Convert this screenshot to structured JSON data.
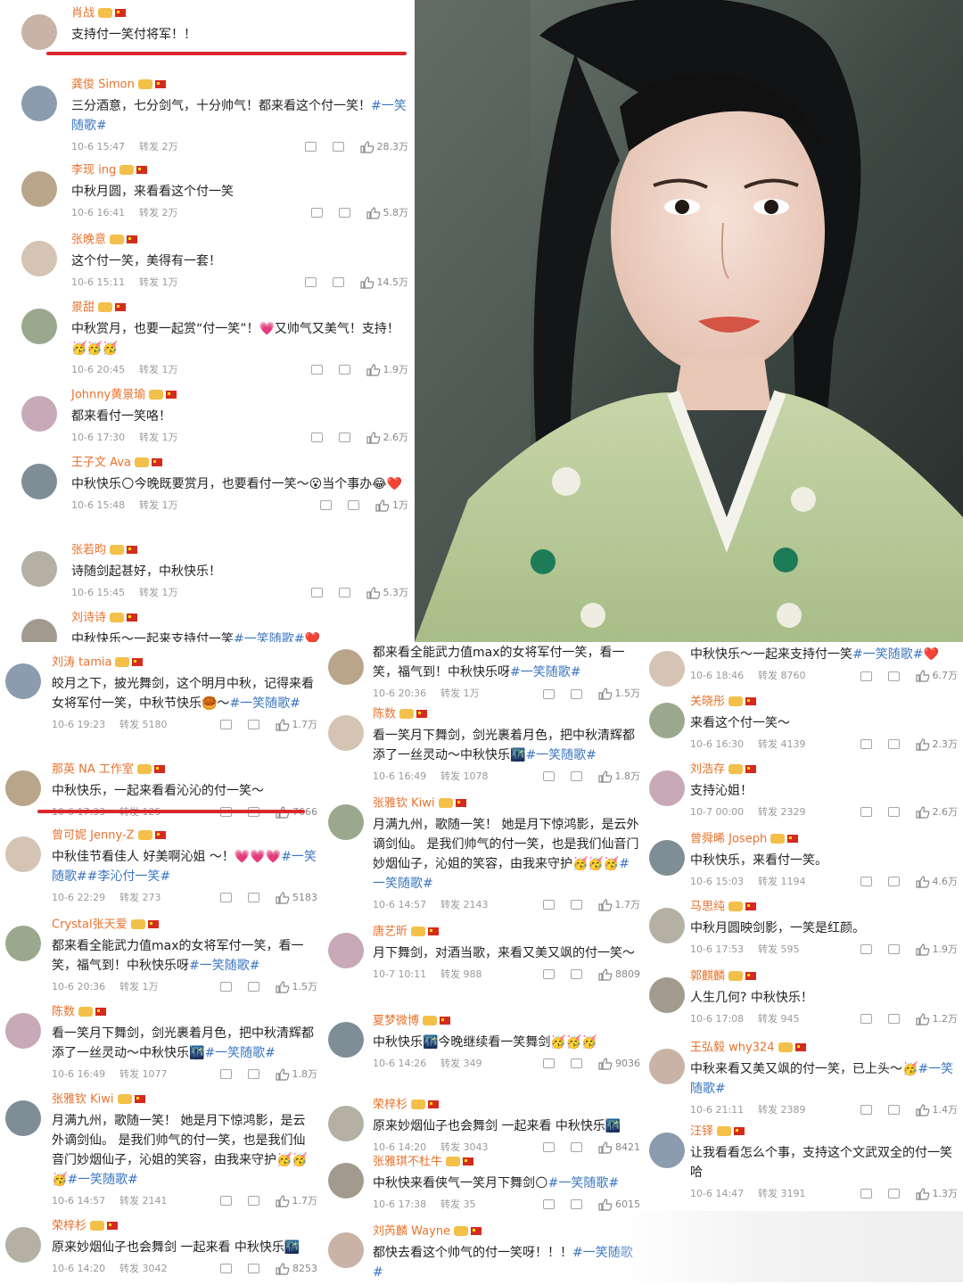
{
  "panels": [
    {
      "id": "top-left",
      "comments": [
        {
          "name": "肖战",
          "text": "支持付一笑付将军！！",
          "emoji": "🥳🥳",
          "time": "",
          "forward": "",
          "likes": ""
        },
        {
          "name": "龚俊 Simon",
          "text": "三分酒意，七分剑气，十分帅气！都来看这个付一笑！",
          "tag": "#一笑随歌#",
          "time": "10-6 15:47",
          "forward": "转发 2万",
          "likes": "28.3万"
        },
        {
          "name": "李现 ing",
          "text": "中秋月圆，来看看这个付一笑",
          "tag": "",
          "time": "10-6 16:41",
          "forward": "转发 2万",
          "likes": "5.8万"
        },
        {
          "name": "张晚意",
          "text": "这个付一笑，美得有一套！",
          "tag": "",
          "time": "10-6 15:11",
          "forward": "转发 1万",
          "likes": "14.5万"
        },
        {
          "name": "景甜",
          "text": "中秋赏月，也要一起赏“付一笑”！💗又帅气又美气！支持！🥳🥳🥳",
          "tag": "",
          "time": "10-6 20:45",
          "forward": "转发 1万",
          "likes": "1.9万"
        },
        {
          "name": "Johnny黄景瑜",
          "text": "都来看付一笑咯！",
          "tag": "",
          "time": "10-6 17:30",
          "forward": "转发 1万",
          "likes": "2.6万"
        },
        {
          "name": "王子文 Ava",
          "text": "中秋快乐🌕今晚既要赏月，也要看付一笑～😮当个事办😂❤️",
          "tag": "",
          "time": "10-6 15:48",
          "forward": "转发 1万",
          "likes": "1万"
        },
        {
          "name": "张若昀",
          "text": "诗随剑起甚好，中秋快乐！",
          "tag": "",
          "time": "10-6 15:45",
          "forward": "转发 1万",
          "likes": "5.3万"
        },
        {
          "name": "刘诗诗",
          "text": "中秋快乐～一起来支持付一笑",
          "tag": "#一笑随歌#❤️",
          "time": "",
          "forward": "",
          "likes": ""
        }
      ]
    },
    {
      "id": "bottom-left",
      "comments": [
        {
          "name": "刘涛 tamia",
          "text": "皎月之下，披光舞剑，这个明月中秋，记得来看女将军付一笑，中秋节快乐🥮～",
          "tag": "#一笑随歌#",
          "time": "10-6 19:23",
          "forward": "转发 5180",
          "likes": "1.7万"
        },
        {
          "name": "那英 NA 工作室",
          "text": "中秋快乐，一起来看看沁沁的付一笑～",
          "tag": "",
          "time": "10-6 17:33",
          "forward": "转发 125",
          "likes": "7666"
        },
        {
          "name": "曾可妮 Jenny-Z",
          "text": "中秋佳节看佳人 好美啊沁姐 ～！💗💗💗",
          "tag": "#一笑随歌##李沁付一笑#",
          "time": "10-6 22:29",
          "forward": "转发 273",
          "likes": "5183"
        },
        {
          "name": "Crystal张天爱",
          "text": "都来看全能武力值max的女将军付一笑，看一笑，福气到！中秋快乐呀",
          "tag": "#一笑随歌#",
          "time": "10-6 20:36",
          "forward": "转发 1万",
          "likes": "1.5万"
        },
        {
          "name": "陈数",
          "text": "看一笑月下舞剑，剑光裹着月色，把中秋清辉都添了一丝灵动～中秋快乐🌃",
          "tag": "#一笑随歌#",
          "time": "10-6 16:49",
          "forward": "转发 1077",
          "likes": "1.8万"
        },
        {
          "name": "张雅钦 Kiwi",
          "text": "月满九州，歌随一笑！ 她是月下惊鸿影，是云外谪剑仙。 是我们帅气的付一笑，也是我们仙音门妙烟仙子，沁姐的笑容，由我来守护🥳🥳🥳",
          "tag": "#一笑随歌#",
          "time": "10-6 14:57",
          "forward": "转发 2141",
          "likes": "1.7万"
        },
        {
          "name": "荣梓杉",
          "text": "原来妙烟仙子也会舞剑 一起来看 中秋快乐🌃",
          "tag": "",
          "time": "10-6 14:20",
          "forward": "转发 3042",
          "likes": "8253"
        }
      ]
    },
    {
      "id": "bottom-middle",
      "comments": [
        {
          "name": "",
          "text": "都来看全能武力值max的女将军付一笑，看一笑，福气到！中秋快乐呀",
          "tag": "#一笑随歌#",
          "time": "10-6 20:36",
          "forward": "转发 1万",
          "likes": "1.5万"
        },
        {
          "name": "陈数",
          "text": "看一笑月下舞剑，剑光裹着月色，把中秋清辉都添了一丝灵动～中秋快乐🌃",
          "tag": "#一笑随歌#",
          "time": "10-6 16:49",
          "forward": "转发 1078",
          "likes": "1.8万"
        },
        {
          "name": "张雅钦 Kiwi",
          "text": "月满九州，歌随一笑！ 她是月下惊鸿影，是云外谪剑仙。 是我们帅气的付一笑，也是我们仙音门妙烟仙子，沁姐的笑容，由我来守护🥳🥳🥳",
          "tag": "#一笑随歌#",
          "time": "10-6 14:57",
          "forward": "转发 2143",
          "likes": "1.7万"
        },
        {
          "name": "唐艺昕",
          "text": "月下舞剑，对酒当歌，来看又美又飒的付一笑～",
          "tag": "",
          "time": "10-7 10:11",
          "forward": "转发 988",
          "likes": "8809"
        },
        {
          "name": "夏梦微博",
          "text": "中秋快乐🌃今晚继续看一笑舞剑🥳🥳🥳",
          "tag": "",
          "time": "10-6 14:26",
          "forward": "转发 349",
          "likes": "9036"
        },
        {
          "name": "荣梓杉",
          "text": "原来妙烟仙子也会舞剑 一起来看 中秋快乐🌃",
          "tag": "",
          "time": "10-6 14:20",
          "forward": "转发 3043",
          "likes": "8421"
        },
        {
          "name": "张雅琪不杜牛",
          "text": "中秋快来看侠气一笑月下舞剑🌕",
          "tag": "#一笑随歌#",
          "time": "10-6 17:38",
          "forward": "转发 35",
          "likes": "6015"
        },
        {
          "name": "刘芮麟 Wayne",
          "text": "都快去看这个帅气的付一笑呀！！！",
          "tag": "#一笑随歌#",
          "time": "",
          "forward": "",
          "likes": ""
        }
      ]
    },
    {
      "id": "bottom-right",
      "comments": [
        {
          "name": "",
          "text": "中秋快乐～一起来支持付一笑",
          "tag": "#一笑随歌#❤️",
          "time": "10-6 18:46",
          "forward": "转发 8760",
          "likes": "6.7万"
        },
        {
          "name": "关晓彤",
          "text": "来看这个付一笑～",
          "tag": "",
          "time": "10-6 16:30",
          "forward": "转发 4139",
          "likes": "2.3万"
        },
        {
          "name": "刘浩存",
          "text": "支持沁姐！",
          "tag": "",
          "time": "10-7 00:00",
          "forward": "转发 2329",
          "likes": "2.6万"
        },
        {
          "name": "曾舜晞 Joseph",
          "text": "中秋快乐，来看付一笑。",
          "tag": "",
          "time": "10-6 15:03",
          "forward": "转发 1194",
          "likes": "4.6万"
        },
        {
          "name": "马思纯",
          "text": "中秋月圆映剑影，一笑是红颜。",
          "tag": "",
          "time": "10-6 17:53",
          "forward": "转发 595",
          "likes": "1.9万"
        },
        {
          "name": "郭麒麟",
          "text": "人生几何? 中秋快乐！",
          "tag": "",
          "time": "10-6 17:08",
          "forward": "转发 945",
          "likes": "1.2万"
        },
        {
          "name": "王弘毅 why324",
          "text": "中秋来看又美又飒的付一笑，已上头～🥳",
          "tag": "#一笑随歌#",
          "time": "10-6 21:11",
          "forward": "转发 2389",
          "likes": "1.4万"
        },
        {
          "name": "汪铎",
          "text": "让我看看怎么个事，支持这个文武双全的付一笑哈",
          "tag": "",
          "time": "10-6 14:47",
          "forward": "转发 3191",
          "likes": "1.3万"
        }
      ]
    }
  ]
}
